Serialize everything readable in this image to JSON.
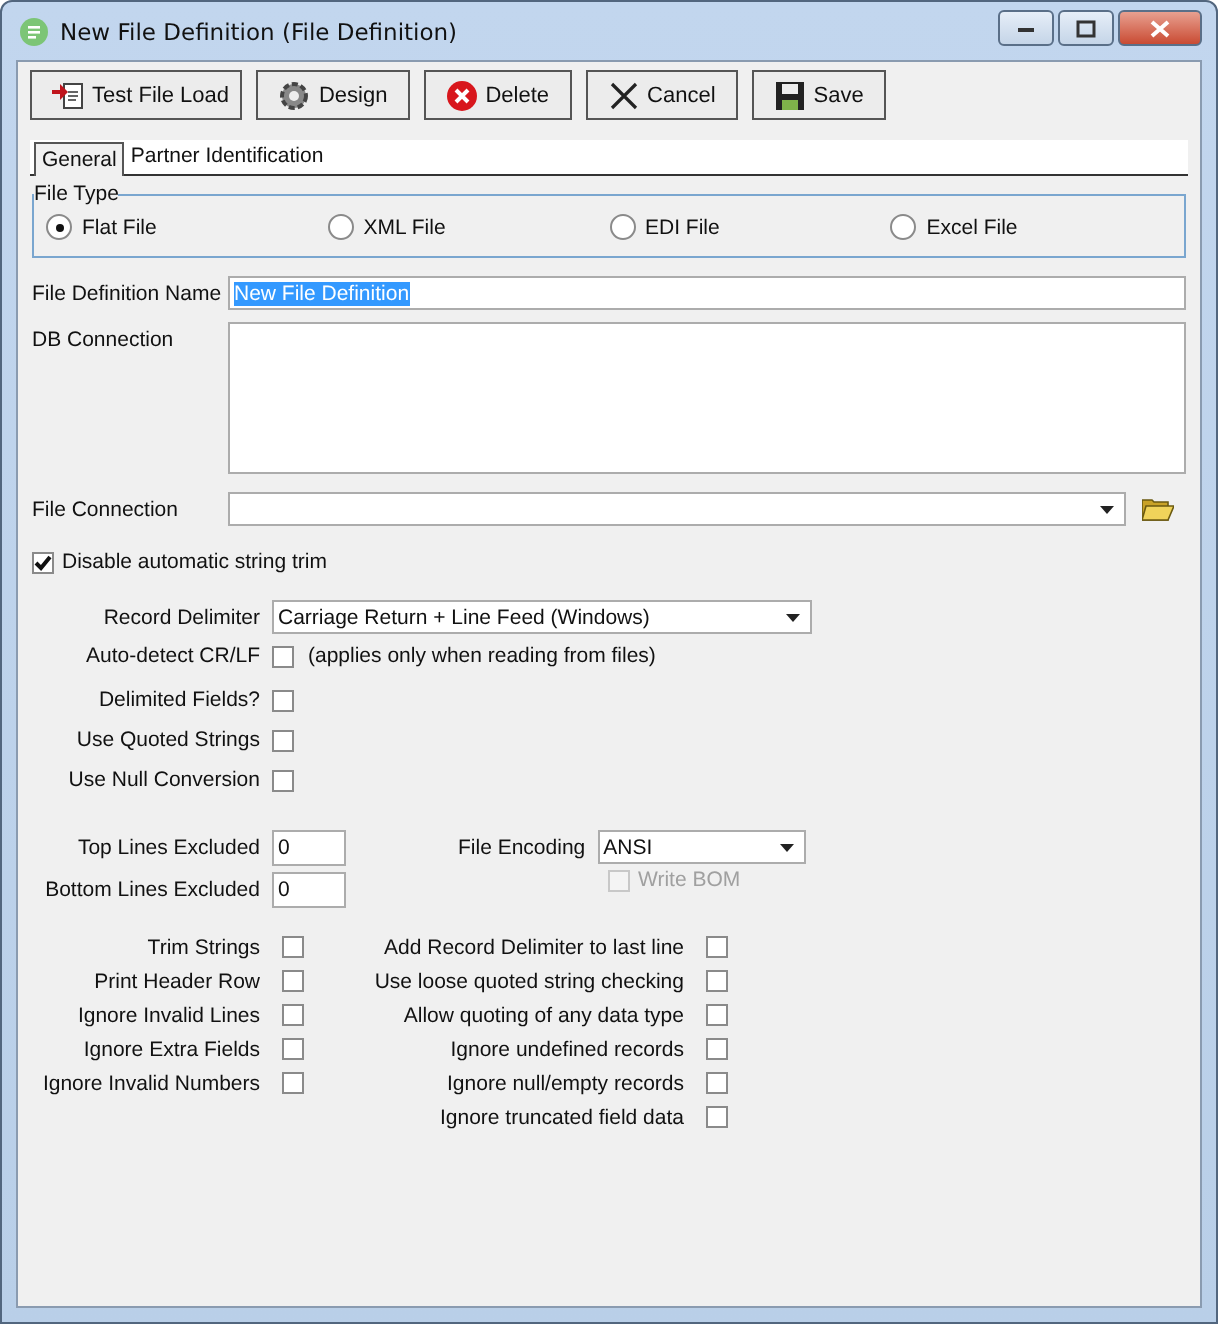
{
  "window": {
    "title": "New File Definition (File Definition)"
  },
  "toolbar": [
    {
      "label": "Test File Load",
      "kind": "load"
    },
    {
      "label": "Design",
      "kind": "design"
    },
    {
      "label": "Delete",
      "kind": "delete"
    },
    {
      "label": "Cancel",
      "kind": "cancel"
    },
    {
      "label": "Save",
      "kind": "save"
    }
  ],
  "tabs": [
    {
      "label": "General",
      "selected": true
    },
    {
      "label": "Partner Identification",
      "selected": false
    }
  ],
  "file_type": {
    "legend": "File Type",
    "options": [
      {
        "label": "Flat File",
        "selected": true
      },
      {
        "label": "XML File",
        "selected": false
      },
      {
        "label": "EDI File",
        "selected": false
      },
      {
        "label": "Excel File",
        "selected": false
      }
    ]
  },
  "file_definition_name": {
    "label": "File Definition Name",
    "value": "New File Definition"
  },
  "db_connection": {
    "label": "DB Connection"
  },
  "file_connection": {
    "label": "File Connection"
  },
  "disable_trim": {
    "label": "Disable automatic string trim",
    "checked": true
  },
  "record_delimiter": {
    "label": "Record Delimiter",
    "value": "Carriage Return + Line Feed (Windows)"
  },
  "auto_detect": {
    "label": "Auto-detect CR/LF",
    "checked": false,
    "note": "(applies only when reading from files)"
  },
  "field_options": [
    {
      "label": "Delimited Fields?",
      "checked": false
    },
    {
      "label": "Use Quoted Strings",
      "checked": false
    },
    {
      "label": "Use Null Conversion",
      "checked": false
    }
  ],
  "top_lines": {
    "label": "Top Lines Excluded",
    "value": "0"
  },
  "bottom_lines": {
    "label": "Bottom Lines Excluded",
    "value": "0"
  },
  "file_encoding": {
    "label": "File Encoding",
    "value": "ANSI"
  },
  "write_bom": {
    "label": "Write BOM",
    "checked": false,
    "disabled": true
  },
  "left_options": [
    {
      "label": "Trim Strings",
      "checked": false
    },
    {
      "label": "Print Header Row",
      "checked": false
    },
    {
      "label": "Ignore Invalid Lines",
      "checked": false
    },
    {
      "label": "Ignore Extra Fields",
      "checked": false
    },
    {
      "label": "Ignore Invalid Numbers",
      "checked": false
    }
  ],
  "right_options": [
    {
      "label": "Add Record Delimiter to last line",
      "checked": false
    },
    {
      "label": "Use loose quoted string checking",
      "checked": false
    },
    {
      "label": "Allow quoting of any data type",
      "checked": false
    },
    {
      "label": "Ignore undefined records",
      "checked": false
    },
    {
      "label": "Ignore null/empty records",
      "checked": false
    },
    {
      "label": "Ignore truncated field data",
      "checked": false
    }
  ]
}
